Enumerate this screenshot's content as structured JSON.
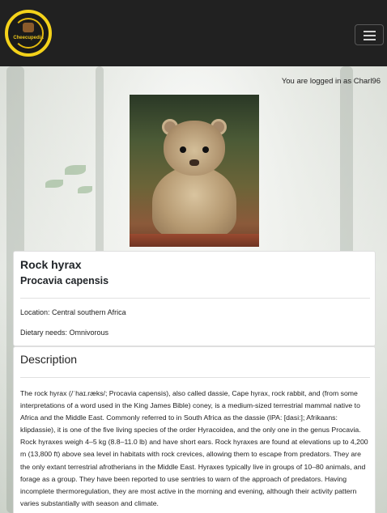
{
  "header": {
    "logo_name": "Cheecupedia",
    "menu_icon": "hamburger-menu-icon"
  },
  "session": {
    "login_text": "You are logged in as Charl96"
  },
  "animal": {
    "photo_alt": "Rock hyrax",
    "name": "Rock hyrax",
    "scientific_name": "Procavia capensis",
    "location": "Location: Central southern Africa",
    "diet": "Dietary needs: Omnivorous"
  },
  "description": {
    "title": "Description",
    "text": "The rock hyrax (/ˈhaɪ.ræks/; Procavia capensis), also called dassie, Cape hyrax, rock rabbit, and (from some interpretations of a word used in the King James Bible) coney, is a medium-sized terrestrial mammal native to Africa and the Middle East. Commonly referred to in South Africa as the dassie (IPA: [dasi:]; Afrikaans: klipdassie), it is one of the five living species of the order Hyracoidea, and the only one in the genus Procavia. Rock hyraxes weigh 4–5 kg (8.8–11.0 lb) and have short ears. Rock hyraxes are found at elevations up to 4,200 m (13,800 ft) above sea level in habitats with rock crevices, allowing them to escape from predators. They are the only extant terrestrial afrotherians in the Middle East. Hyraxes typically live in groups of 10–80 animals, and forage as a group. They have been reported to use sentries to warn of the approach of predators. Having incomplete thermoregulation, they are most active in the morning and evening, although their activity pattern varies substantially with season and climate."
  },
  "colors": {
    "navbar": "#212121",
    "logo_ring": "#f4d21a"
  }
}
